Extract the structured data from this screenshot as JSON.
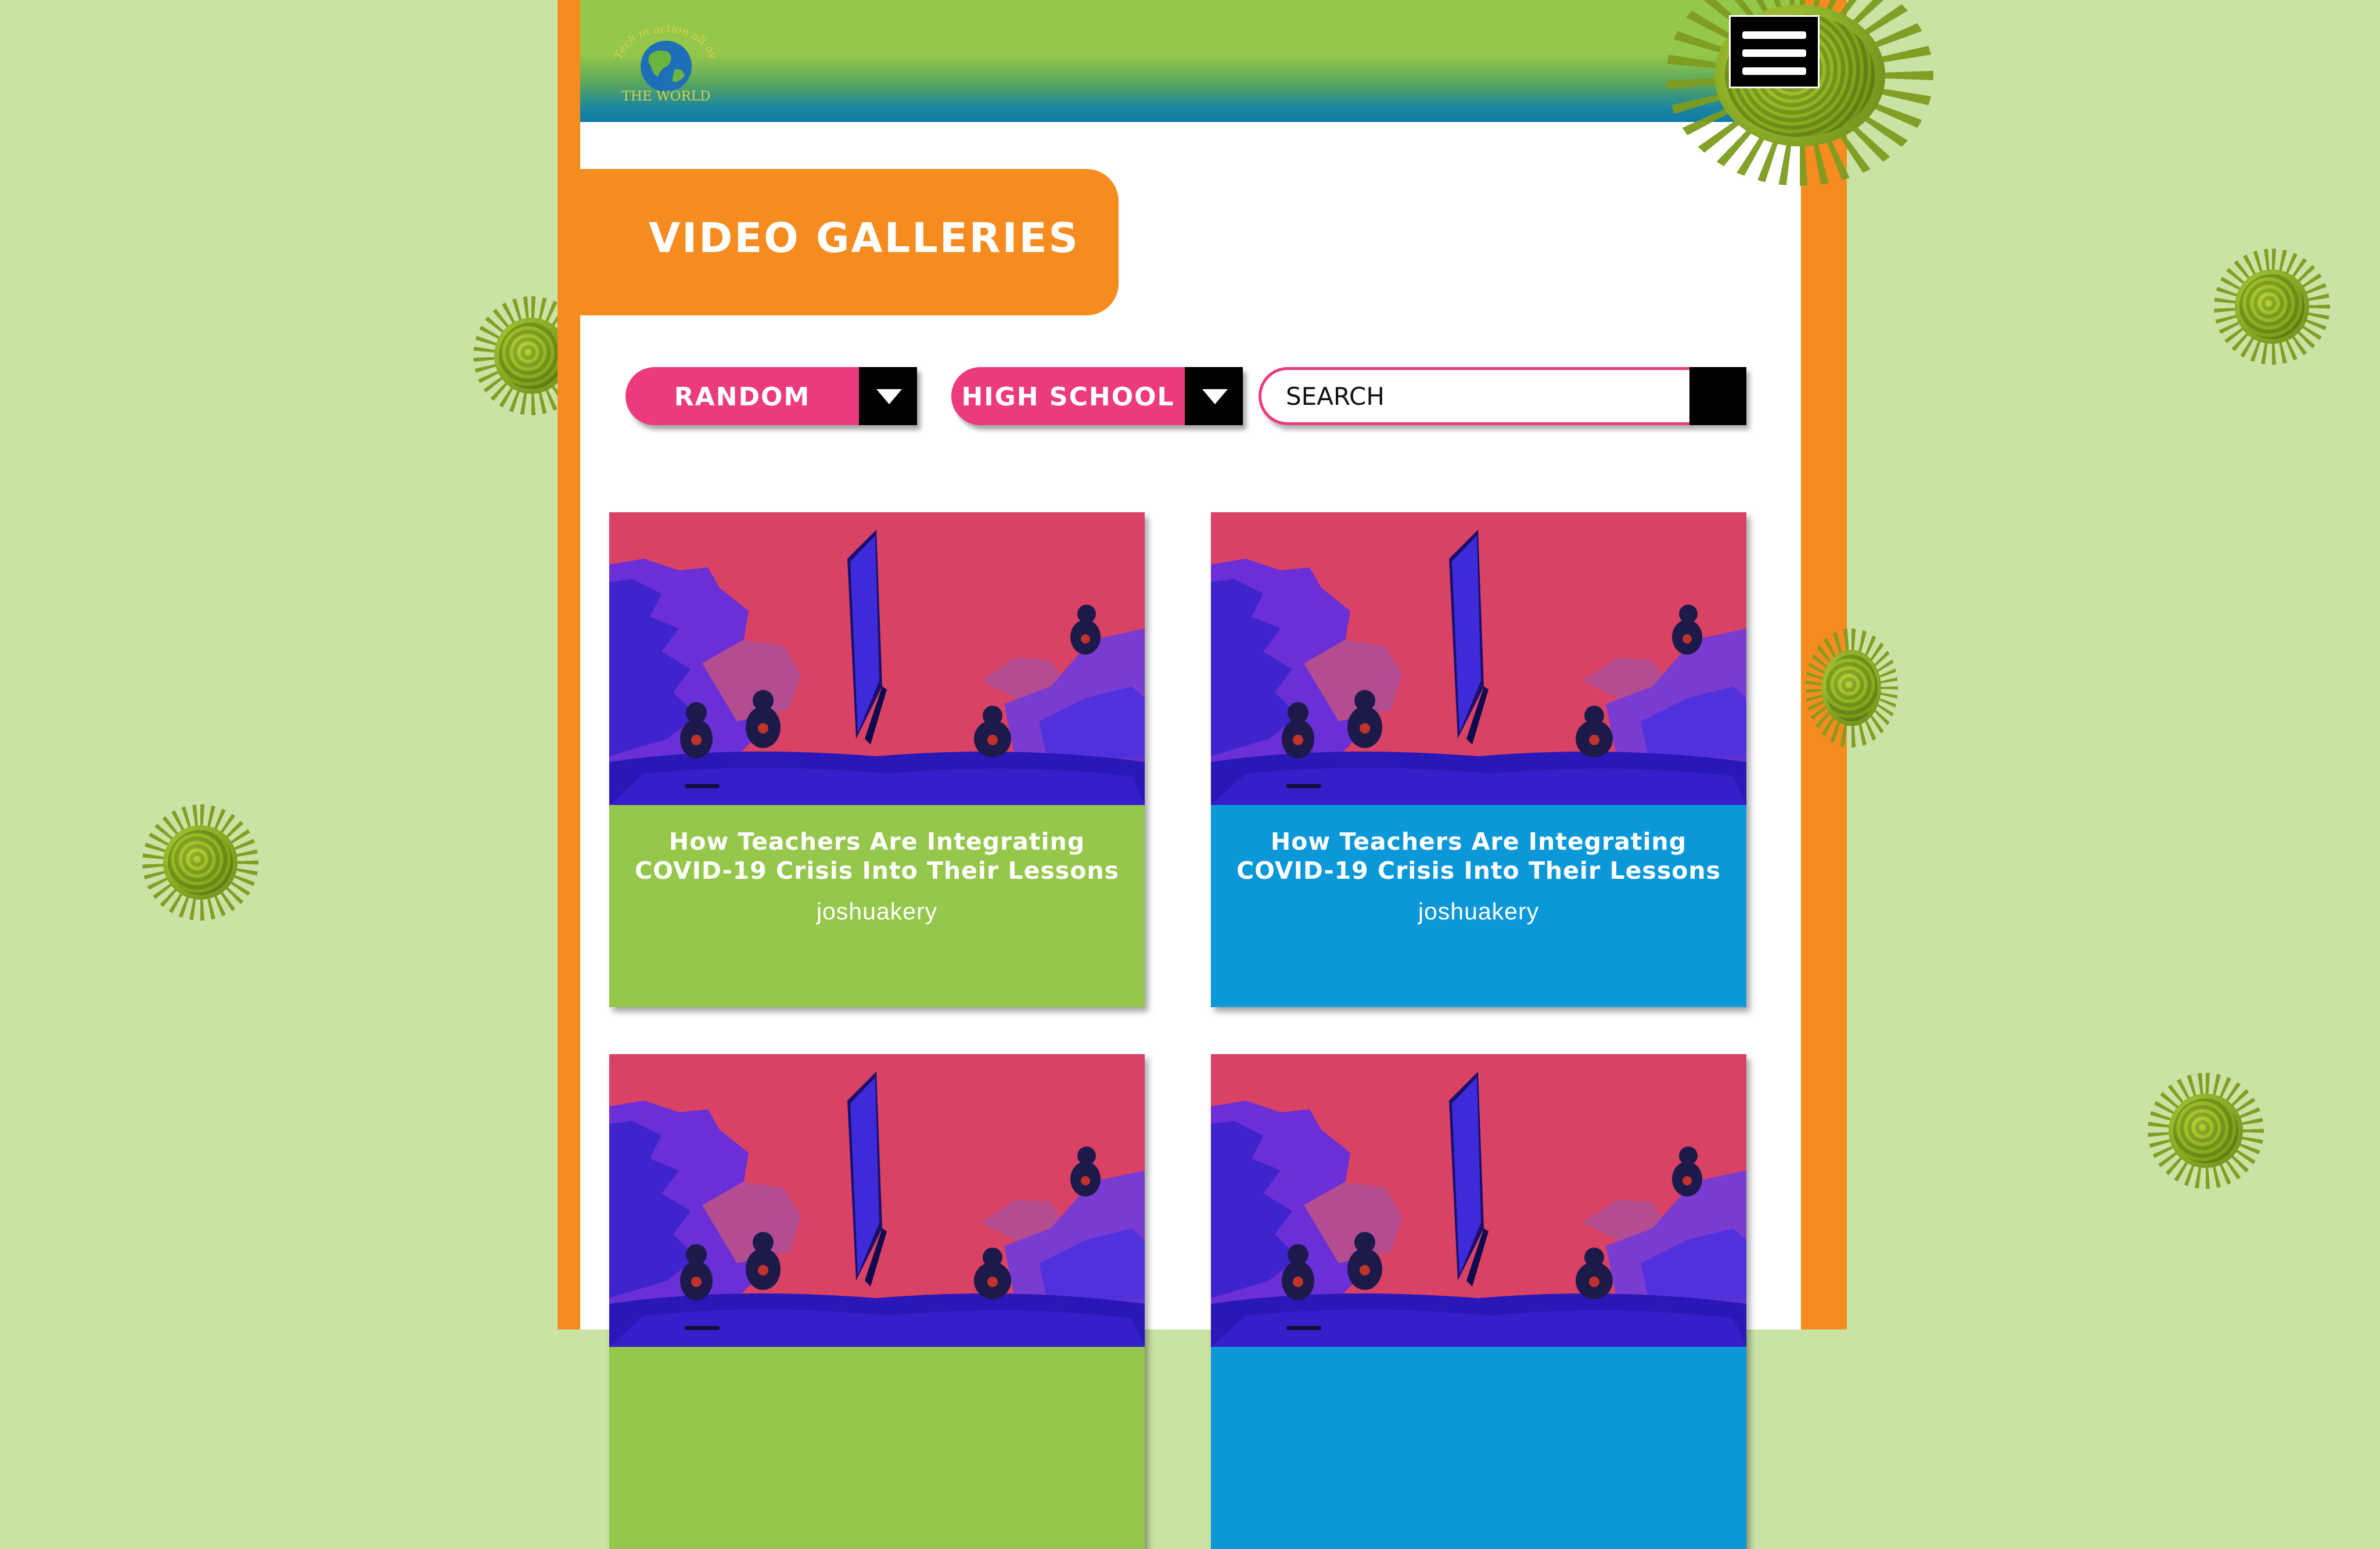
{
  "logo": {
    "arc_text": "Tech in action all over",
    "name": "THE WORLD"
  },
  "header": {
    "menu_icon": "hamburger-menu-icon"
  },
  "page_title": "VIDEO GALLERIES",
  "filters": {
    "sort": {
      "selected": "RANDOM"
    },
    "level": {
      "selected": "HIGH SCHOOL"
    },
    "search": {
      "placeholder": "SEARCH",
      "value": ""
    }
  },
  "colors": {
    "background": "#c9e3a4",
    "frame_orange": "#f68b1f",
    "pink": "#eb3a7e",
    "card_green": "#94c74a",
    "card_blue": "#0b98d9"
  },
  "videos": [
    {
      "title": "How Teachers Are Integrating COVID-19 Crisis Into Their Lessons",
      "author": "joshuakery"
    },
    {
      "title": "How Teachers Are Integrating COVID-19 Crisis Into Their Lessons",
      "author": "joshuakery"
    },
    {
      "title": "",
      "author": ""
    },
    {
      "title": "",
      "author": ""
    }
  ]
}
